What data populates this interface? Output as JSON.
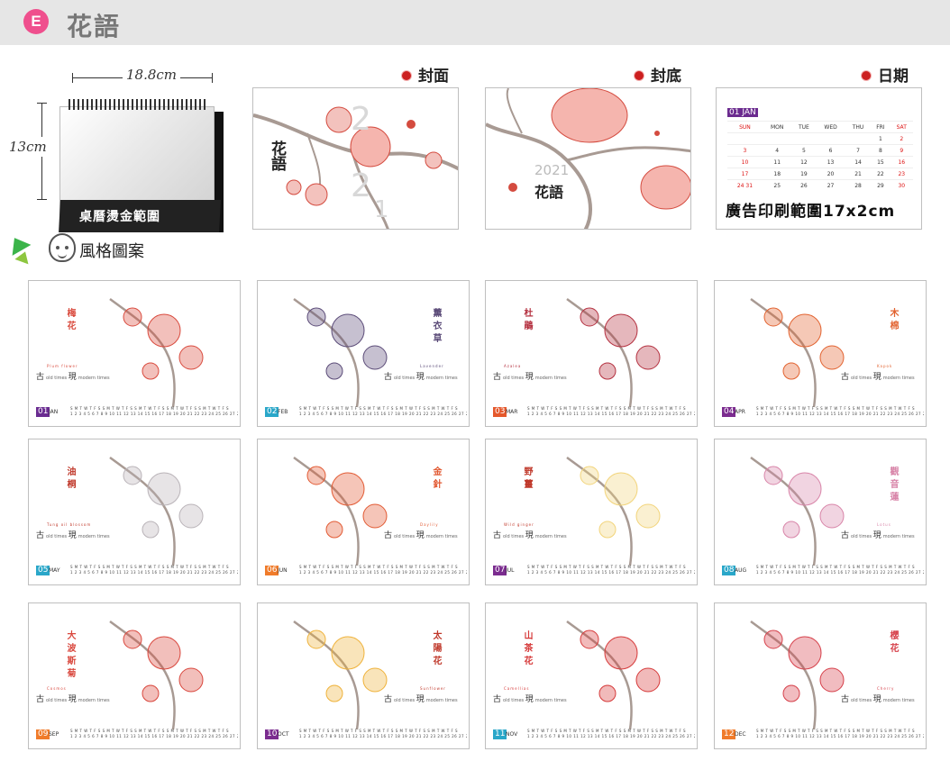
{
  "header": {
    "badge": "E",
    "title": "花語"
  },
  "desk": {
    "width_label": "18.8cm",
    "height_label": "13cm",
    "base_label": "桌曆燙金範圍"
  },
  "sections": {
    "cover": "封面",
    "back": "封底",
    "date": "日期"
  },
  "cover": {
    "title": "花語",
    "year_digits": [
      "2",
      "2",
      "1"
    ]
  },
  "back": {
    "year": "2021",
    "title": "花語"
  },
  "date_panel": {
    "month_num": "01",
    "month_name": "JAN",
    "weekdays": [
      "SUN",
      "MON",
      "TUE",
      "WED",
      "THU",
      "FRI",
      "SAT"
    ],
    "rows": [
      [
        "",
        "",
        "",
        "",
        "",
        "1",
        "2"
      ],
      [
        "3",
        "4",
        "5",
        "6",
        "7",
        "8",
        "9"
      ],
      [
        "10",
        "11",
        "12",
        "13",
        "14",
        "15",
        "16"
      ],
      [
        "17",
        "18",
        "19",
        "20",
        "21",
        "22",
        "23"
      ],
      [
        "24 31",
        "25",
        "26",
        "27",
        "28",
        "29",
        "30"
      ]
    ],
    "ad_label": "廣告印刷範圍17x2cm"
  },
  "style_heading": "風格圖案",
  "months": [
    {
      "num": "01",
      "name": "JAN",
      "title": "梅花",
      "sub": "Plum flower",
      "tag_color": "#6a2c91",
      "flower_color": "#d94a3d"
    },
    {
      "num": "02",
      "name": "FEB",
      "title": "薰衣草",
      "sub": "Lavender",
      "tag_color": "#2aa7c9",
      "flower_color": "#5b4b78"
    },
    {
      "num": "03",
      "name": "MAR",
      "title": "杜鵑",
      "sub": "Azalea",
      "tag_color": "#e5582c",
      "flower_color": "#b4303f"
    },
    {
      "num": "04",
      "name": "APR",
      "title": "木棉",
      "sub": "Kapok",
      "tag_color": "#7b2c8f",
      "flower_color": "#e2622f"
    },
    {
      "num": "05",
      "name": "MAY",
      "title": "油桐",
      "sub": "Tung oil blossom",
      "tag_color": "#2aa7c9",
      "flower_color": "#b9b3b8"
    },
    {
      "num": "06",
      "name": "JUN",
      "title": "金針",
      "sub": "Daylily",
      "tag_color": "#f07b2a",
      "flower_color": "#e25a33"
    },
    {
      "num": "07",
      "name": "JUL",
      "title": "野薑",
      "sub": "Wild ginger",
      "tag_color": "#7b2c8f",
      "flower_color": "#f2d47a"
    },
    {
      "num": "08",
      "name": "AUG",
      "title": "觀音蓮",
      "sub": "Lotus",
      "tag_color": "#2aa7c9",
      "flower_color": "#d884a8"
    },
    {
      "num": "09",
      "name": "SEP",
      "title": "大波斯菊",
      "sub": "Cosmos",
      "tag_color": "#f07b2a",
      "flower_color": "#d9473d"
    },
    {
      "num": "10",
      "name": "OCT",
      "title": "太陽花",
      "sub": "Sunflower",
      "tag_color": "#7b2c8f",
      "flower_color": "#efb23a"
    },
    {
      "num": "11",
      "name": "NOV",
      "title": "山茶花",
      "sub": "Camellias",
      "tag_color": "#2aa7c9",
      "flower_color": "#d63a3a"
    },
    {
      "num": "12",
      "name": "DEC",
      "title": "櫻花",
      "sub": "Cherry",
      "tag_color": "#f07b2a",
      "flower_color": "#d6404a"
    }
  ],
  "text_block": {
    "old": "古",
    "old_sub": "old times",
    "now": "現",
    "now_sub": "modern times"
  },
  "day_strip": "S M T W T F S S M T W T F S S M T W T F S S M T W T F S S M T W T F S",
  "day_nums": "1 2 3 4 5 6 7 8 9 10 11 12 13 14 15 16 17 18 19 20 21 22 23 24 25 26 27 28 29 30 31"
}
